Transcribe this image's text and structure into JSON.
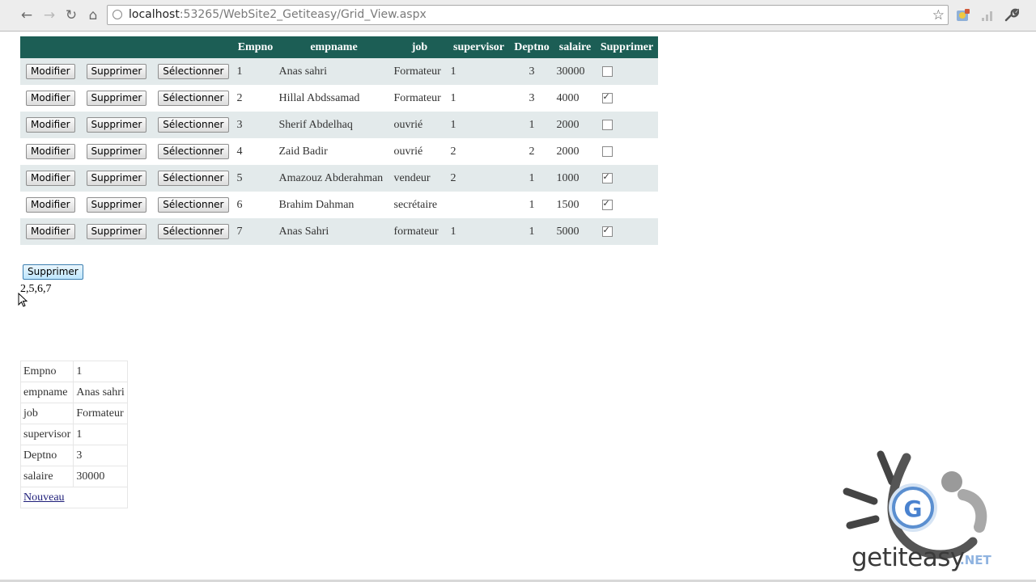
{
  "browser": {
    "url_host": "localhost",
    "url_rest": ":53265/WebSite2_Getiteasy/Grid_View.aspx",
    "icons": [
      "back-icon",
      "forward-icon",
      "reload-icon",
      "home-icon",
      "bookmark-star-icon",
      "extension-icon",
      "signal-icon",
      "wrench-icon"
    ]
  },
  "grid": {
    "headers": [
      "",
      "",
      "",
      "Empno",
      "empname",
      "job",
      "supervisor",
      "Deptno",
      "salaire",
      "Supprimer"
    ],
    "edit_label": "Modifier",
    "delete_label": "Supprimer",
    "select_label": "Sélectionner",
    "rows": [
      {
        "empno": "1",
        "empname": "Anas sahri",
        "job": "Formateur",
        "supervisor": "1",
        "deptno": "3",
        "salaire": "30000",
        "checked": false
      },
      {
        "empno": "2",
        "empname": "Hillal Abdssamad",
        "job": "Formateur",
        "supervisor": "1",
        "deptno": "3",
        "salaire": "4000",
        "checked": true
      },
      {
        "empno": "3",
        "empname": "Sherif Abdelhaq",
        "job": "ouvrié",
        "supervisor": "1",
        "deptno": "1",
        "salaire": "2000",
        "checked": false
      },
      {
        "empno": "4",
        "empname": "Zaid Badir",
        "job": "ouvrié",
        "supervisor": "2",
        "deptno": "2",
        "salaire": "2000",
        "checked": false
      },
      {
        "empno": "5",
        "empname": "Amazouz Abderahman",
        "job": "vendeur",
        "supervisor": "2",
        "deptno": "1",
        "salaire": "1000",
        "checked": true
      },
      {
        "empno": "6",
        "empname": "Brahim Dahman",
        "job": "secrétaire",
        "supervisor": "",
        "deptno": "1",
        "salaire": "1500",
        "checked": true
      },
      {
        "empno": "7",
        "empname": "Anas Sahri",
        "job": "formateur",
        "supervisor": "1",
        "deptno": "1",
        "salaire": "5000",
        "checked": true
      }
    ]
  },
  "bulk_delete_label": "Supprimer",
  "selected_ids": "2,5,6,7",
  "details": {
    "rows": [
      {
        "label": "Empno",
        "value": "1"
      },
      {
        "label": "empname",
        "value": "Anas sahri"
      },
      {
        "label": "job",
        "value": "Formateur"
      },
      {
        "label": "supervisor",
        "value": "1"
      },
      {
        "label": "Deptno",
        "value": "3"
      },
      {
        "label": "salaire",
        "value": "30000"
      }
    ],
    "new_link": "Nouveau"
  },
  "watermark": {
    "brand": "getiteasy",
    "suffix": ".NET",
    "logo_letter": "G"
  }
}
